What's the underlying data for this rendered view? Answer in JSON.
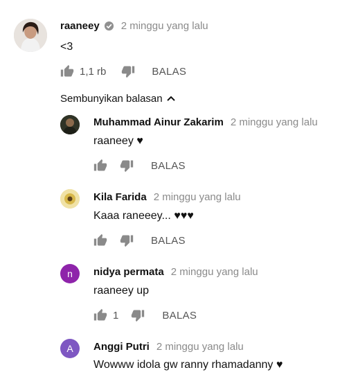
{
  "top_comment": {
    "author": "raaneey",
    "time": "2 minggu yang lalu",
    "text": "<3",
    "likes": "1,1 rb",
    "reply_label": "BALAS"
  },
  "replies_toggle": "Sembunyikan balasan",
  "replies": [
    {
      "author": "Muhammad Ainur Zakarim",
      "time": "2 minggu yang lalu",
      "text": "raaneey ♥",
      "reply_label": "BALAS"
    },
    {
      "author": "Kila Farida",
      "time": "2 minggu yang lalu",
      "text": "Kaaa raneeey... ♥♥♥",
      "reply_label": "BALAS"
    },
    {
      "author": "nidya permata",
      "time": "2 minggu yang lalu",
      "text": "raaneey up",
      "likes": "1",
      "reply_label": "BALAS",
      "avatar_letter": "n",
      "avatar_color": "#8e24aa"
    },
    {
      "author": "Anggi Putri",
      "time": "2 minggu yang lalu",
      "text": "Wowww idola gw ranny rhamadanny ♥",
      "avatar_letter": "A",
      "avatar_color": "#7e57c2"
    }
  ]
}
